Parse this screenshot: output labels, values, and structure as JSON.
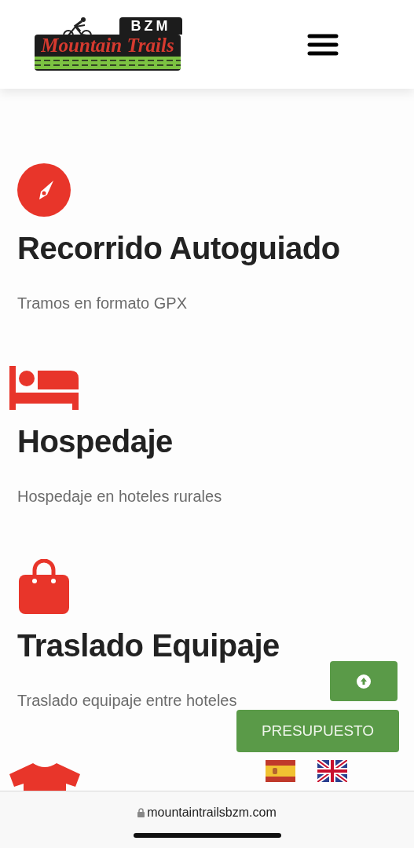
{
  "header": {
    "logo": {
      "badge": "BZM",
      "name": "Mountain Trails"
    }
  },
  "services": [
    {
      "kind": "compass",
      "title": "Recorrido Autoguiado",
      "description": "Tramos en formato GPX"
    },
    {
      "kind": "bed",
      "title": "Hospedaje",
      "description": "Hospedaje en hoteles rurales"
    },
    {
      "kind": "bag",
      "title": "Traslado Equipaje",
      "description": "Traslado equipaje entre hoteles"
    },
    {
      "kind": "shirt"
    }
  ],
  "quote_button": "PRESUPUESTO",
  "languages": [
    {
      "kind": "es"
    },
    {
      "kind": "gb"
    }
  ],
  "browser_bar": {
    "url": "mountaintrailsbzm.com"
  }
}
